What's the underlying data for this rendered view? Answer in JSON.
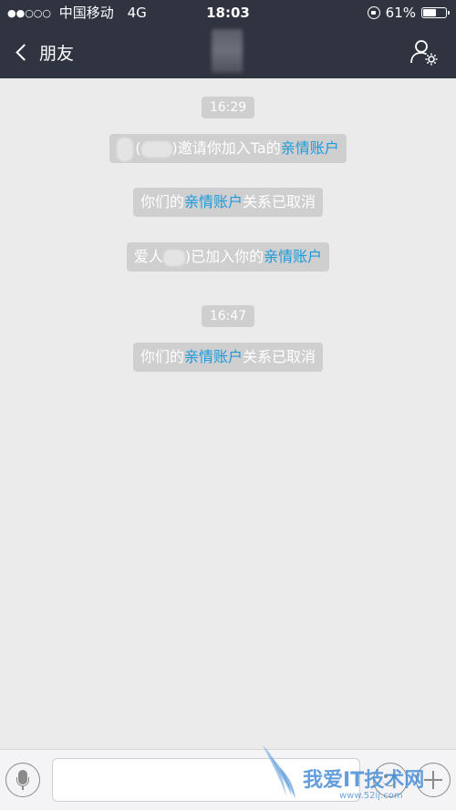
{
  "status_bar": {
    "signal": "●●○○○",
    "carrier": "中国移动",
    "network": "4G",
    "time": "18:03",
    "battery_percent": "61%",
    "battery_level": 0.61
  },
  "nav": {
    "back_label": "朋友"
  },
  "messages": [
    {
      "type": "time",
      "text": "16:29"
    },
    {
      "type": "system",
      "parts": {
        "open": "(",
        "mid": ")邀请你加入Ta的",
        "link": "亲情账户"
      }
    },
    {
      "type": "system",
      "parts": {
        "pre": "你们的",
        "link": "亲情账户",
        "post": "关系已取消"
      }
    },
    {
      "type": "system",
      "parts": {
        "pre": "爱人",
        "mid": ")已加入你的",
        "link": "亲情账户"
      }
    },
    {
      "type": "time",
      "text": "16:47"
    },
    {
      "type": "system",
      "parts": {
        "pre": "你们的",
        "link": "亲情账户",
        "post": "关系已取消"
      }
    }
  ],
  "input": {
    "placeholder": ""
  },
  "watermark": {
    "text": "我爱IT技术网",
    "url": "www.52ij.com"
  }
}
